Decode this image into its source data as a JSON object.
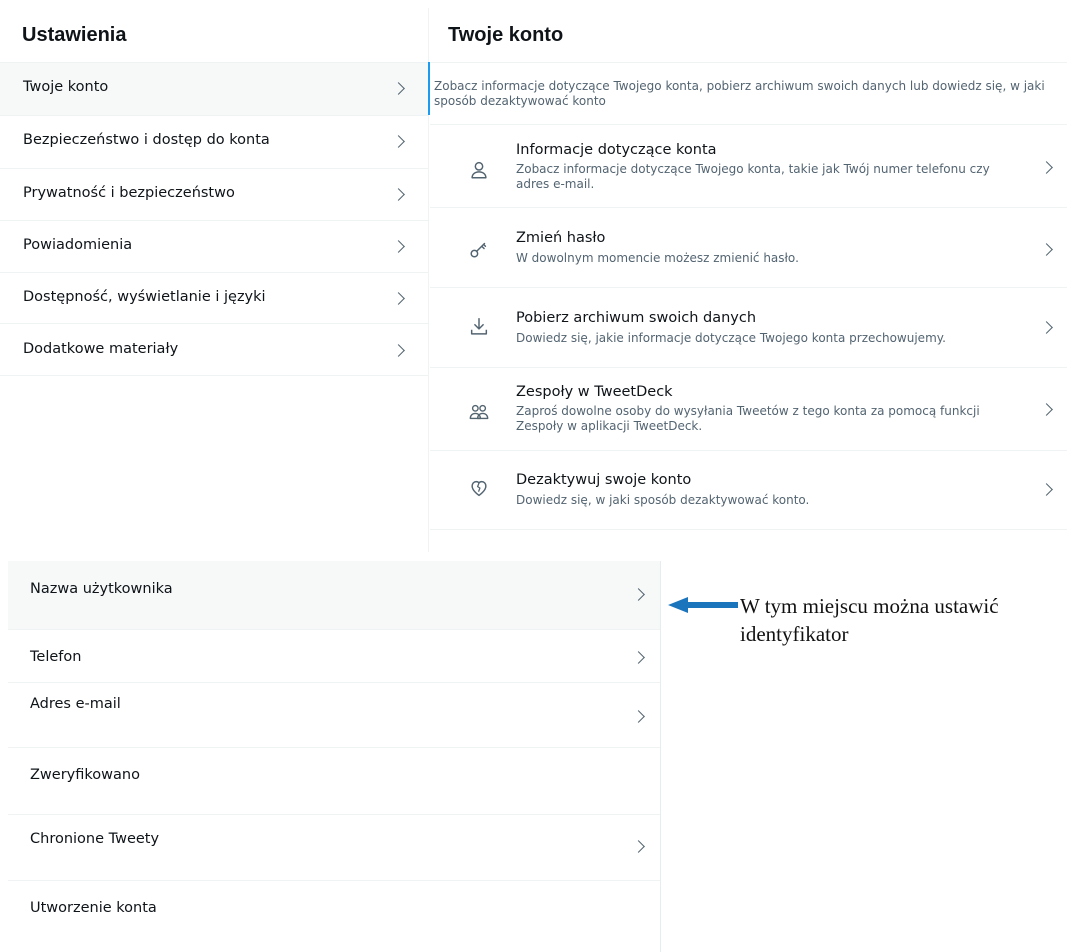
{
  "settings": {
    "title": "Ustawienia",
    "items": [
      {
        "label": "Twoje konto",
        "active": true
      },
      {
        "label": "Bezpieczeństwo i dostęp do konta"
      },
      {
        "label": "Prywatność i bezpieczeństwo"
      },
      {
        "label": "Powiadomienia"
      },
      {
        "label": "Dostępność, wyświetlanie i języki"
      },
      {
        "label": "Dodatkowe materiały"
      }
    ]
  },
  "account": {
    "title": "Twoje konto",
    "intro": "Zobacz informacje dotyczące Twojego konta, pobierz archiwum swoich danych lub dowiedz się, w jaki sposób dezaktywować konto",
    "options": [
      {
        "title": "Informacje dotyczące konta",
        "description": "Zobacz informacje dotyczące Twojego konta, takie jak Twój numer telefonu czy adres e-mail.",
        "icon": "person-icon"
      },
      {
        "title": "Zmień hasło",
        "description": "W dowolnym momencie możesz zmienić hasło.",
        "icon": "key-icon"
      },
      {
        "title": "Pobierz archiwum swoich danych",
        "description": "Dowiedz się, jakie informacje dotyczące Twojego konta przechowujemy.",
        "icon": "download-icon"
      },
      {
        "title": "Zespoły w TweetDeck",
        "description": "Zaproś dowolne osoby do wysyłania Tweetów z tego konta za pomocą funkcji Zespoły w aplikacji TweetDeck.",
        "icon": "people-icon"
      },
      {
        "title": "Dezaktywuj swoje konto",
        "description": "Dowiedz się, w jaki sposób dezaktywować konto.",
        "icon": "broken-heart-icon"
      }
    ]
  },
  "account_info": {
    "items": [
      {
        "label": "Nazwa użytkownika",
        "has_chevron": true
      },
      {
        "label": "Telefon",
        "has_chevron": true
      },
      {
        "label": "Adres e-mail",
        "has_chevron": true
      },
      {
        "label": "Zweryfikowano",
        "has_chevron": false
      },
      {
        "label": "Chronione Tweety",
        "has_chevron": true
      },
      {
        "label": "Utworzenie konta",
        "has_chevron": false
      }
    ]
  },
  "annotation": {
    "line1": "W tym miejscu można ustawić",
    "line2": "identyfikator"
  },
  "colors": {
    "accent": "#1d9bf0",
    "arrow": "#1b75bc",
    "text_primary": "#0f1419",
    "text_secondary": "#536471",
    "active_bg": "#f7f9f9"
  }
}
